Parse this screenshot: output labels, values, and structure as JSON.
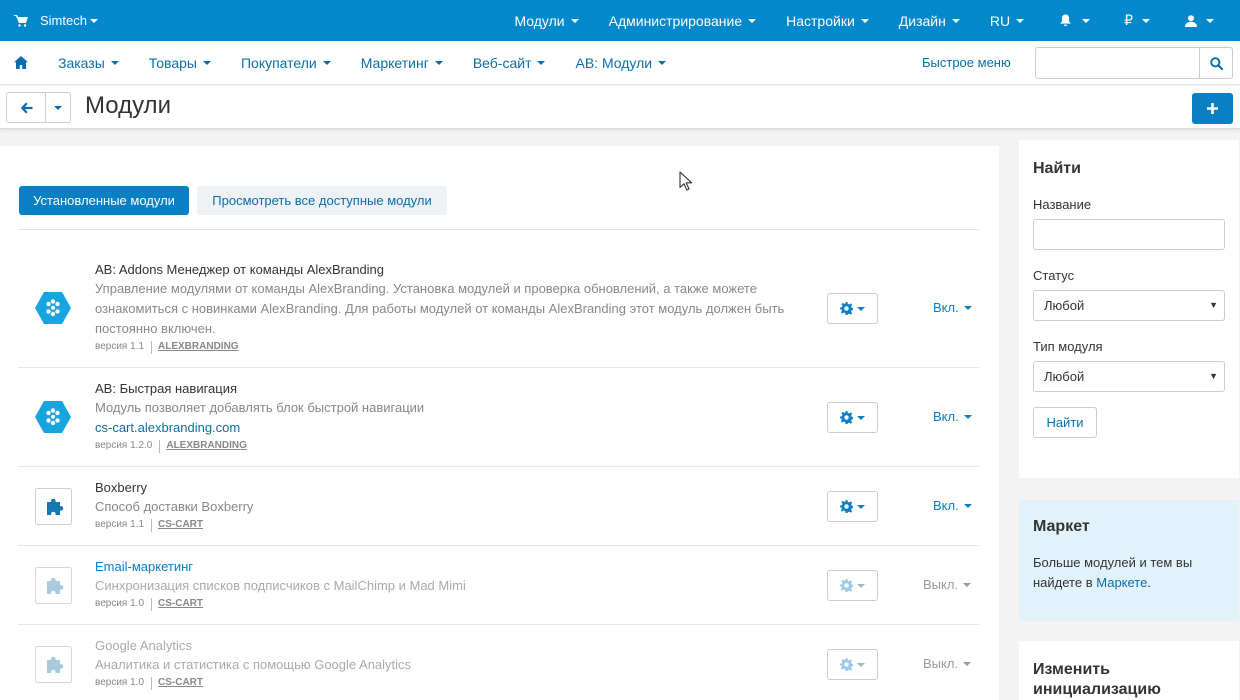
{
  "topbar": {
    "brand": "Simtech",
    "menu": [
      {
        "label": "Модули"
      },
      {
        "label": "Администрирование"
      },
      {
        "label": "Настройки"
      },
      {
        "label": "Дизайн"
      },
      {
        "label": "RU"
      }
    ],
    "currency_symbol": "₽",
    "icons": [
      "cart-icon",
      "bell-icon",
      "user-icon"
    ],
    "bg_color": "#0388cc"
  },
  "navbar": {
    "home_icon": "home-icon",
    "items": [
      {
        "label": "Заказы"
      },
      {
        "label": "Товары"
      },
      {
        "label": "Покупатели"
      },
      {
        "label": "Маркетинг"
      },
      {
        "label": "Веб-сайт"
      },
      {
        "label": "AB: Модули"
      }
    ],
    "quick_menu": "Быстрое меню",
    "search": {
      "value": "",
      "placeholder": ""
    }
  },
  "title": {
    "page_title": "Модули"
  },
  "tabs": [
    {
      "label": "Установленные модули",
      "active": true
    },
    {
      "label": "Просмотреть все доступные модули",
      "active": false
    }
  ],
  "addons": [
    {
      "name": "AB: Addons Менеджер от команды AlexBranding",
      "description": "Управление модулями от команды AlexBranding. Установка модулей и проверка обновлений, а также можете ознакомиться с новинками AlexBranding. Для работы модулей от команды AlexBranding этот модуль должен быть постоянно включен.",
      "link": "",
      "version": "версия 1.1",
      "author": "ALEXBRANDING",
      "status": "Вкл.",
      "icon": "alexbranding-logo-icon"
    },
    {
      "name": "AB: Быстрая навигация",
      "description": "Модуль позволяет добавлять блок быстрой навигации",
      "link": "cs-cart.alexbranding.com",
      "version": "версия 1.2.0",
      "author": "ALEXBRANDING",
      "status": "Вкл.",
      "icon": "alexbranding-logo-icon"
    },
    {
      "name": "Boxberry",
      "description": "Способ доставки Boxberry",
      "link": "",
      "version": "версия 1.1",
      "author": "CS-CART",
      "status": "Вкл.",
      "icon": "puzzle-icon"
    },
    {
      "name": "Email-маркетинг",
      "description": "Синхронизация списков подписчиков с MailChimp и Mad Mimi",
      "link": "",
      "version": "версия 1.0",
      "author": "CS-CART",
      "status": "Выкл.",
      "icon": "puzzle-icon"
    },
    {
      "name": "Google Analytics",
      "description": "Аналитика и статистика с помощью Google Analytics",
      "link": "",
      "version": "версия 1.0",
      "author": "CS-CART",
      "status": "Выкл.",
      "icon": "puzzle-icon"
    }
  ],
  "sidebar": {
    "search": {
      "title": "Найти",
      "name_label": "Название",
      "name_value": "",
      "status_label": "Статус",
      "status_value": "Любой",
      "type_label": "Тип модуля",
      "type_value": "Любой",
      "button": "Найти"
    },
    "market": {
      "title": "Маркет",
      "text": "Больше модулей и тем вы найдете в ",
      "link": "Маркете",
      "after": "."
    },
    "init": {
      "title": "Изменить инициализацию"
    }
  },
  "colors": {
    "accent": "#0a7fc4",
    "link": "#0a6fa8",
    "market_bg": "#e2f2fb"
  }
}
